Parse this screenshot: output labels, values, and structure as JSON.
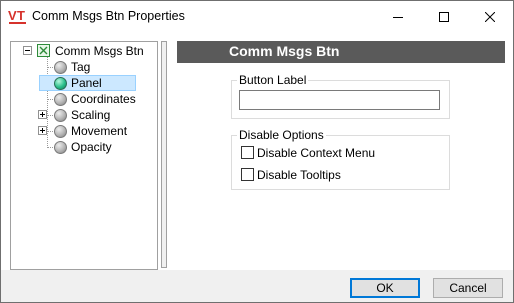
{
  "window": {
    "title": "Comm Msgs Btn Properties",
    "app_icon": "vt-scada-icon",
    "controls": [
      "minimize-icon",
      "maximize-icon",
      "close-icon"
    ]
  },
  "tree": {
    "root": {
      "label": "Comm Msgs Btn",
      "expanded": true
    },
    "items": [
      {
        "label": "Tag",
        "icon": "gray-dot-icon",
        "expander": "none",
        "selected": false
      },
      {
        "label": "Panel",
        "icon": "green-dot-icon",
        "expander": "none",
        "selected": true
      },
      {
        "label": "Coordinates",
        "icon": "gray-dot-icon",
        "expander": "none",
        "selected": false
      },
      {
        "label": "Scaling",
        "icon": "gray-dot-icon",
        "expander": "plus",
        "selected": false
      },
      {
        "label": "Movement",
        "icon": "gray-dot-icon",
        "expander": "plus",
        "selected": false
      },
      {
        "label": "Opacity",
        "icon": "gray-dot-icon",
        "expander": "none",
        "selected": false
      }
    ]
  },
  "panel": {
    "header": "Comm Msgs Btn",
    "button_label_group": {
      "legend": "Button Label",
      "value": ""
    },
    "disable_options_group": {
      "legend": "Disable Options",
      "options": [
        {
          "label": "Disable Context Menu",
          "checked": false
        },
        {
          "label": "Disable Tooltips",
          "checked": false
        }
      ]
    }
  },
  "footer": {
    "ok_label": "OK",
    "cancel_label": "Cancel"
  },
  "colors": {
    "header_bg": "#5a5a5a",
    "selection_bg": "#cce8ff",
    "ok_border": "#0078d7"
  }
}
